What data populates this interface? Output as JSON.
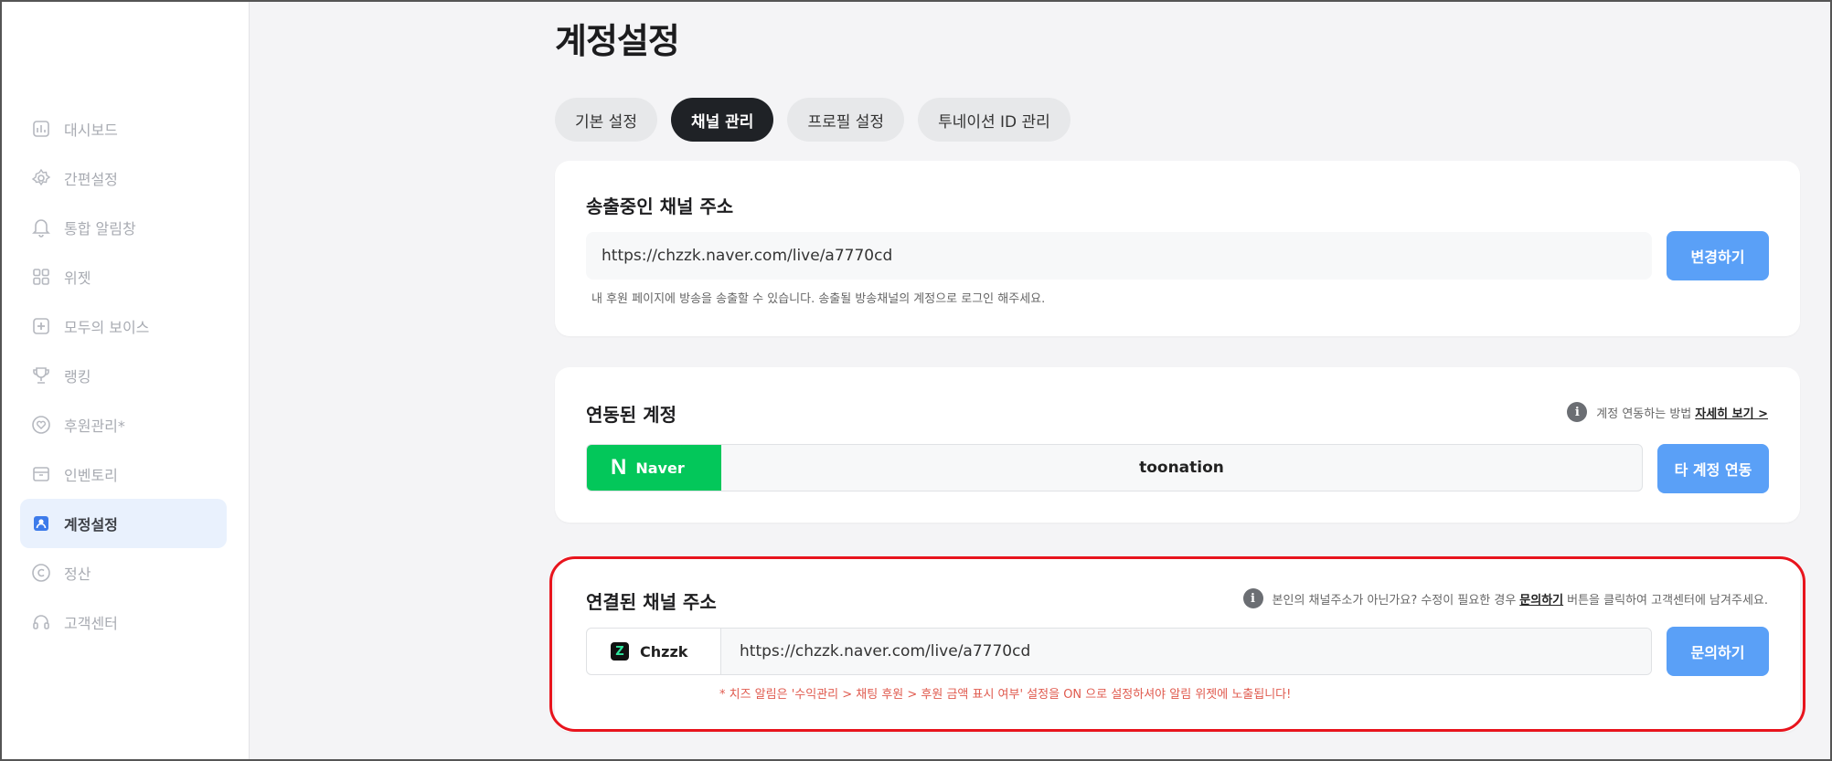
{
  "sidebar": {
    "items": [
      {
        "label": "대시보드",
        "icon": "dashboard-icon"
      },
      {
        "label": "간편설정",
        "icon": "gear-icon"
      },
      {
        "label": "통합 알림창",
        "icon": "bell-icon"
      },
      {
        "label": "위젯",
        "icon": "widget-grid-icon"
      },
      {
        "label": "모두의 보이스",
        "icon": "voice-plus-icon"
      },
      {
        "label": "랭킹",
        "icon": "trophy-icon"
      },
      {
        "label": "후원관리*",
        "icon": "heart-icon"
      },
      {
        "label": "인벤토리",
        "icon": "inventory-box-icon"
      },
      {
        "label": "계정설정",
        "icon": "user-icon",
        "active": true
      },
      {
        "label": "정산",
        "icon": "copyright-coin-icon"
      },
      {
        "label": "고객센터",
        "icon": "headset-icon"
      }
    ]
  },
  "page": {
    "title": "계정설정"
  },
  "tabs": [
    {
      "label": "기본 설정"
    },
    {
      "label": "채널 관리",
      "active": true
    },
    {
      "label": "프로필 설정"
    },
    {
      "label": "투네이션 ID 관리"
    }
  ],
  "broadcast_card": {
    "title": "송출중인 채널 주소",
    "url": "https://chzzk.naver.com/live/a7770cd",
    "button": "변경하기",
    "hint": "내 후원 페이지에 방송을 송출할 수 있습니다. 송출될 방송채널의 계정으로 로그인 해주세요."
  },
  "linked_account_card": {
    "title": "연동된 계정",
    "info_text": "계정 연동하는 방법",
    "info_link": "자세히 보기 >",
    "provider": "Naver",
    "provider_logo": "N",
    "account_name": "toonation",
    "button": "타 계정 연동",
    "provider_color": "#03c75a"
  },
  "connected_channel_card": {
    "title": "연결된 채널 주소",
    "info_text_before": "본인의 채널주소가 아닌가요? 수정이 필요한 경우",
    "info_link": "문의하기",
    "info_text_after": "버튼을 클릭하여 고객센터에 남겨주세요.",
    "platform": "Chzzk",
    "platform_logo": "Z",
    "url": "https://chzzk.naver.com/live/a7770cd",
    "button": "문의하기",
    "warning": "* 치즈 알림은 '수익관리 > 채팅 후원 > 후원 금액 표시 여부' 설정을 ON 으로 설정하셔야 알림 위젯에 노출됩니다!"
  },
  "colors": {
    "accent_blue": "#5aa0f7",
    "highlight_red": "#e8141d",
    "warning_red": "#e05a4e"
  }
}
